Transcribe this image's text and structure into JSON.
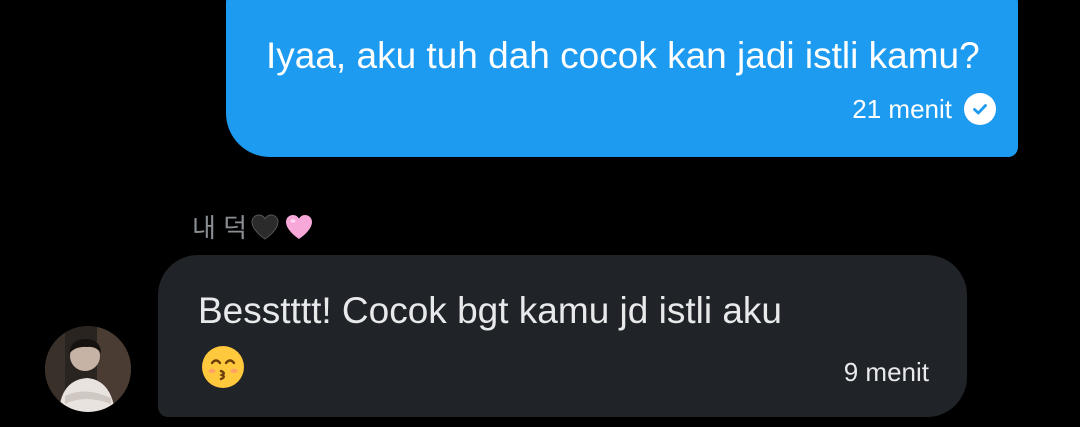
{
  "conversation": {
    "outgoing": {
      "text": "Iyaa, aku tuh dah cocok kan jadi istli kamu?",
      "time": "21 menit",
      "status_icon": "check-circle-icon",
      "bubble_color": "#1d9bf0"
    },
    "incoming": {
      "sender_name": "내 덕",
      "sender_badges": [
        "black-heart-icon",
        "pink-heart-icon"
      ],
      "text": "Besstttt! Cocok bgt kamu jd istli aku",
      "emoji": "kissing-face-with-smiling-eyes-icon",
      "time": "9 menit",
      "bubble_color": "#202327"
    }
  },
  "theme": {
    "background": "#000000",
    "muted_text": "#8b8f94"
  }
}
